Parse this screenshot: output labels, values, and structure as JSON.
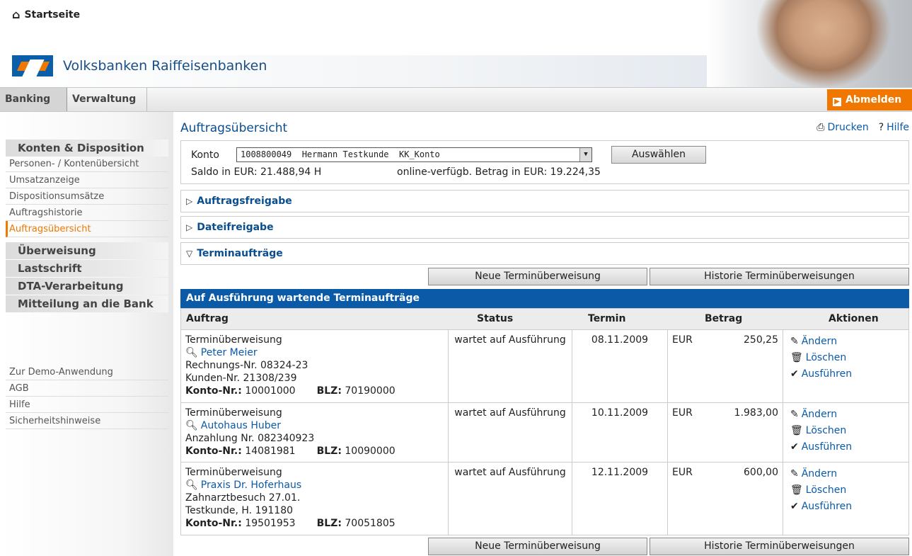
{
  "header": {
    "home_label": "Startseite",
    "brand_name": "Volksbanken Raiffeisenbanken"
  },
  "tabs": [
    {
      "label": "Banking",
      "active": true
    },
    {
      "label": "Verwaltung",
      "active": false
    }
  ],
  "logout_label": "Abmelden",
  "sidebar": {
    "groups": [
      "Konten & Disposition",
      "Überweisung",
      "Lastschrift",
      "DTA-Verarbeitung",
      "Mitteilung an die Bank"
    ],
    "items": [
      "Personen- / Kontenübersicht",
      "Umsatzanzeige",
      "Dispositionsumsätze",
      "Auftragshistorie",
      "Auftragsübersicht"
    ],
    "bottom_links": [
      "Zur Demo-Anwendung",
      "AGB",
      "Hilfe",
      "Sicherheitshinweise"
    ]
  },
  "main": {
    "title": "Auftragsübersicht",
    "print_label": "Drucken",
    "help_label": "Hilfe",
    "konto_label": "Konto",
    "konto_value": "1008800049  Hermann Testkunde  KK_Konto",
    "select_button": "Auswählen",
    "saldo": "Saldo in EUR: 21.488,94 H",
    "verfuegbar": "online-verfügb. Betrag in EUR: 19.224,35",
    "sections": [
      {
        "label": "Auftragsfreigabe",
        "expanded": false
      },
      {
        "label": "Dateifreigabe",
        "expanded": false
      },
      {
        "label": "Terminaufträge",
        "expanded": true
      }
    ],
    "new_button": "Neue Terminüberweisung",
    "history_button": "Historie Terminüberweisungen",
    "table_caption": "Auf Ausführung wartende Terminaufträge",
    "columns": [
      "Auftrag",
      "Status",
      "Termin",
      "Betrag",
      "Aktionen"
    ],
    "konto_nr_label": "Konto-Nr.:",
    "blz_label": "BLZ:",
    "actions": [
      "Ändern",
      "Löschen",
      "Ausführen"
    ],
    "rows": [
      {
        "type": "Terminüberweisung",
        "payee": "Peter Meier",
        "lines": [
          "Rechnungs-Nr. 08324-23",
          "Kunden-Nr. 21308/239"
        ],
        "konto": "10001000",
        "blz": "70190000",
        "status": "wartet auf Ausführung",
        "termin": "08.11.2009",
        "currency": "EUR",
        "amount": "250,25"
      },
      {
        "type": "Terminüberweisung",
        "payee": "Autohaus Huber",
        "lines": [
          "Anzahlung Nr. 082340923"
        ],
        "konto": "14081981",
        "blz": "10090000",
        "status": "wartet auf Ausführung",
        "termin": "10.11.2009",
        "currency": "EUR",
        "amount": "1.983,00"
      },
      {
        "type": "Terminüberweisung",
        "payee": "Praxis Dr. Hoferhaus",
        "lines": [
          "Zahnarztbesuch 27.01.",
          "Testkunde, H. 191180"
        ],
        "konto": "19501953",
        "blz": "70051805",
        "status": "wartet auf Ausführung",
        "termin": "12.11.2009",
        "currency": "EUR",
        "amount": "600,00"
      }
    ]
  },
  "colors": {
    "brand_blue": "#0a5aa8",
    "accent_orange": "#f07800"
  }
}
